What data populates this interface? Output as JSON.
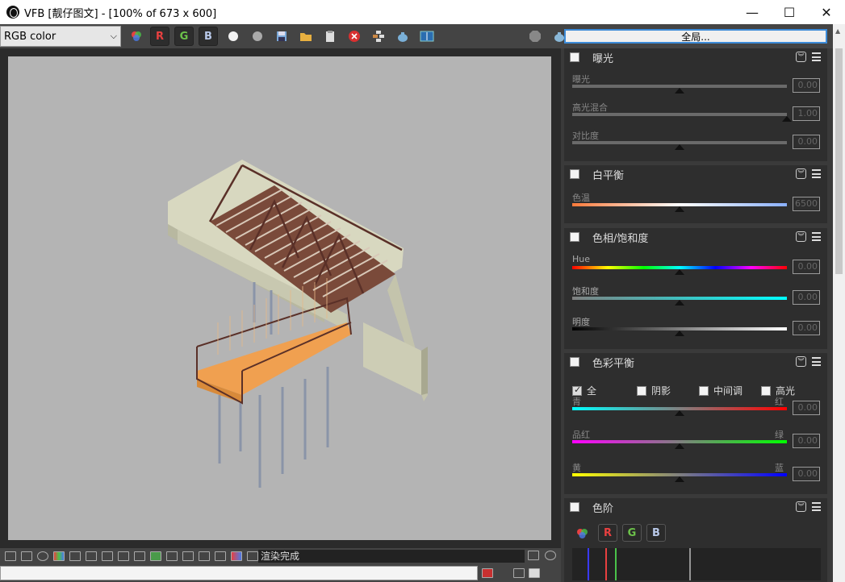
{
  "window": {
    "title": "VFB [靓仔图文] - [100% of 673 x 600]",
    "minimize": "—",
    "maximize": "☐",
    "close": "✕"
  },
  "toolbar": {
    "channel_select": "RGB color",
    "r_label": "R",
    "g_label": "G",
    "b_label": "B",
    "global_button": "全局..."
  },
  "status": {
    "message": "渲染完成"
  },
  "panels": {
    "exposure": {
      "title": "曝光",
      "sliders": [
        {
          "label": "曝光",
          "value": "0.00",
          "pos": 0.5
        },
        {
          "label": "高光混合",
          "value": "1.00",
          "pos": 1.0
        },
        {
          "label": "对比度",
          "value": "0.00",
          "pos": 0.5
        }
      ]
    },
    "white_balance": {
      "title": "白平衡",
      "sliders": [
        {
          "label": "色温",
          "value": "6500",
          "pos": 0.5
        }
      ]
    },
    "hue_sat": {
      "title": "色相/饱和度",
      "sliders": [
        {
          "label": "Hue",
          "value": "0.00",
          "pos": 0.5
        },
        {
          "label": "饱和度",
          "value": "0.00",
          "pos": 0.5
        },
        {
          "label": "明度",
          "value": "0.00",
          "pos": 0.5
        }
      ]
    },
    "color_balance": {
      "title": "色彩平衡",
      "options": [
        {
          "label": "全",
          "checked": true
        },
        {
          "label": "阴影",
          "checked": false
        },
        {
          "label": "中间调",
          "checked": false
        },
        {
          "label": "高光",
          "checked": false
        }
      ],
      "sliders": [
        {
          "left": "青",
          "right": "红",
          "value": "0.00",
          "pos": 0.5
        },
        {
          "left": "品红",
          "right": "绿",
          "value": "0.00",
          "pos": 0.5
        },
        {
          "left": "黄",
          "right": "蓝",
          "value": "0.00",
          "pos": 0.5
        }
      ]
    },
    "levels": {
      "title": "色阶",
      "r_label": "R",
      "g_label": "G",
      "b_label": "B"
    }
  },
  "colors": {
    "accent": "#3c8bd8",
    "r": "#e84040",
    "g": "#6cc24a",
    "b": "#b8c8e8"
  }
}
